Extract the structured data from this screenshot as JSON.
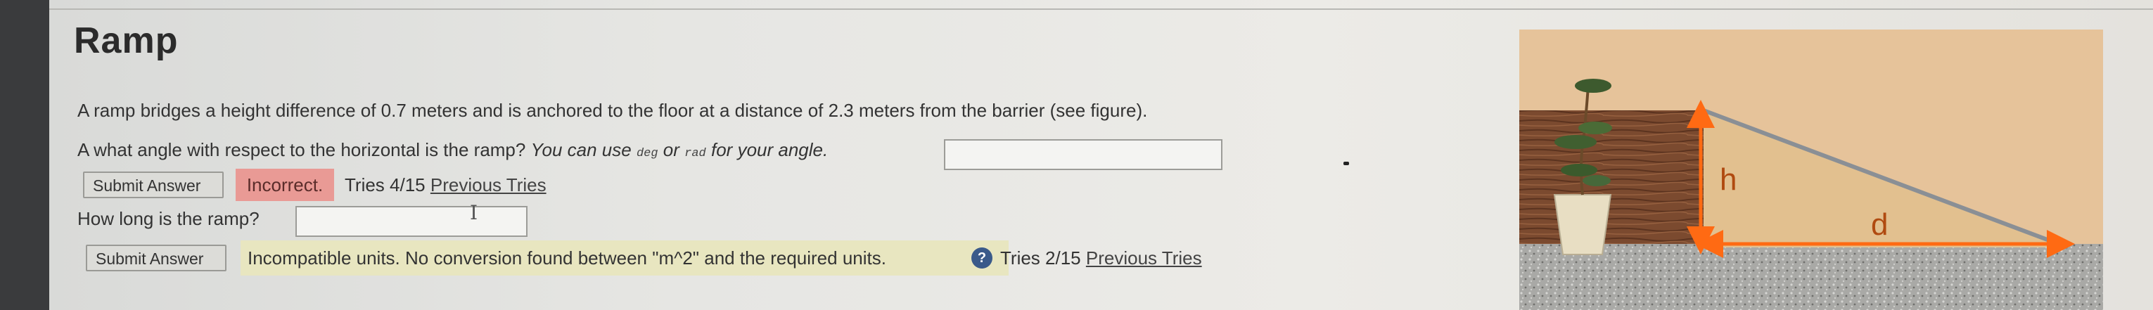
{
  "title": "Ramp",
  "problem": {
    "statement": "A ramp bridges a height difference of 0.7 meters and is anchored to the floor at a distance of 2.3 meters from the barrier (see figure).",
    "q1_prefix": "A what angle with respect to the horizontal is the ramp?",
    "q1_units_pre": "You can use",
    "q1_unit_a": "deg",
    "q1_or": "or",
    "q1_unit_b": "rad",
    "q1_units_post": "for your angle.",
    "q2": "How long is the ramp?"
  },
  "q1": {
    "answer_value": "",
    "submit_label": "Submit Answer",
    "status": "Incorrect.",
    "tries": "Tries 4/15",
    "previous": "Previous Tries"
  },
  "q2": {
    "answer_value": "",
    "submit_label": "Submit Answer",
    "message": "Incompatible units. No conversion found between \"m^2\" and the required units.",
    "help_glyph": "?",
    "tries": "Tries 2/15",
    "previous": "Previous Tries"
  },
  "figure": {
    "label_h": "h",
    "label_d": "d"
  },
  "colors": {
    "incorrect_bg": "#e99a95",
    "warning_bg": "#e8e6c0",
    "arrow": "#ff6a13",
    "ramp": "#8a8f95",
    "wall": "#7d4e34",
    "floor": "#a8a8a5",
    "sky": "#e8c49a"
  }
}
